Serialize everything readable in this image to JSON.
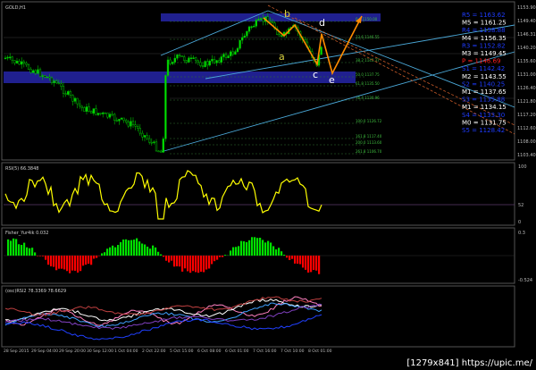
{
  "symbol_label": "GOLD,H1",
  "wave_labels": {
    "a": "a",
    "b": "b",
    "c": "c",
    "d": "d",
    "e": "e"
  },
  "pivot_levels": [
    {
      "label": "R5 = 1163.62",
      "color": "#1f3cff"
    },
    {
      "label": "M5 = 1161.25",
      "color": "#ffffff"
    },
    {
      "label": "R4 = 1158.88",
      "color": "#1f3cff"
    },
    {
      "label": "M4 = 1156.35",
      "color": "#ffffff"
    },
    {
      "label": "R3 = 1152.82",
      "color": "#1f3cff"
    },
    {
      "label": "M3 = 1149.45",
      "color": "#ffffff"
    },
    {
      "label": "P = 1146.69",
      "color": "#ff2020"
    },
    {
      "label": "S1 = 1142.42",
      "color": "#1f3cff"
    },
    {
      "label": "M2 = 1143.55",
      "color": "#ffffff"
    },
    {
      "label": "S2 = 1140.25",
      "color": "#1f3cff"
    },
    {
      "label": "M1 = 1137.65",
      "color": "#ffffff"
    },
    {
      "label": "S3 = 1135.88",
      "color": "#1f3cff"
    },
    {
      "label": "M1 = 1134.15",
      "color": "#ffffff"
    },
    {
      "label": "S4 = 1133.30",
      "color": "#1f3cff"
    },
    {
      "label": "M0 = 1131.75",
      "color": "#ffffff"
    },
    {
      "label": "S5 = 1128.42",
      "color": "#1f3cff"
    }
  ],
  "price_axis": [
    "1153.90",
    "1149.40",
    "1146.31",
    "1140.20",
    "1135.60",
    "1131.00",
    "1126.40",
    "1121.80",
    "1117.20",
    "1112.60",
    "1108.00",
    "1103.40"
  ],
  "fib_labels": [
    "0.0 1150.00",
    "23.6 1146.55",
    "38.2 1143.37",
    "50.0 1137.75",
    "61.8 1135.50",
    "76.4 1130.96",
    "100.0 1126.72",
    "161.8 1117.40",
    "200.0 1113.60",
    "261.8 1106.70"
  ],
  "rsi_panel": {
    "title": "RSI(5) 66.3848",
    "axis": [
      "100",
      "52",
      "0"
    ]
  },
  "fisher_panel": {
    "title": "Fisher_Yur4ik 0.032",
    "axis": [
      "0.3",
      "-0.524"
    ]
  },
  "bottom_panel": {
    "title": "(osc)RSI2 78.3369 78.6629"
  },
  "time_axis": [
    "28 Sep 2015",
    "29 Sep 04:00",
    "29 Sep 20:00",
    "30 Sep 12:00",
    "1 Oct 04:00",
    "2 Oct 22:00",
    "5 Oct 15:00",
    "6 Oct 08:00",
    "6 Oct 01:00",
    "7 Oct 16:00",
    "7 Oct 10:00",
    "8 Oct 01:00"
  ],
  "watermark": "[1279x841] https://upic.me/",
  "colors": {
    "bull": "#00e000",
    "bear": "#ff0000",
    "rsi": "#ffff00",
    "band": "#20208f",
    "zigzag": "#ff8c00"
  }
}
